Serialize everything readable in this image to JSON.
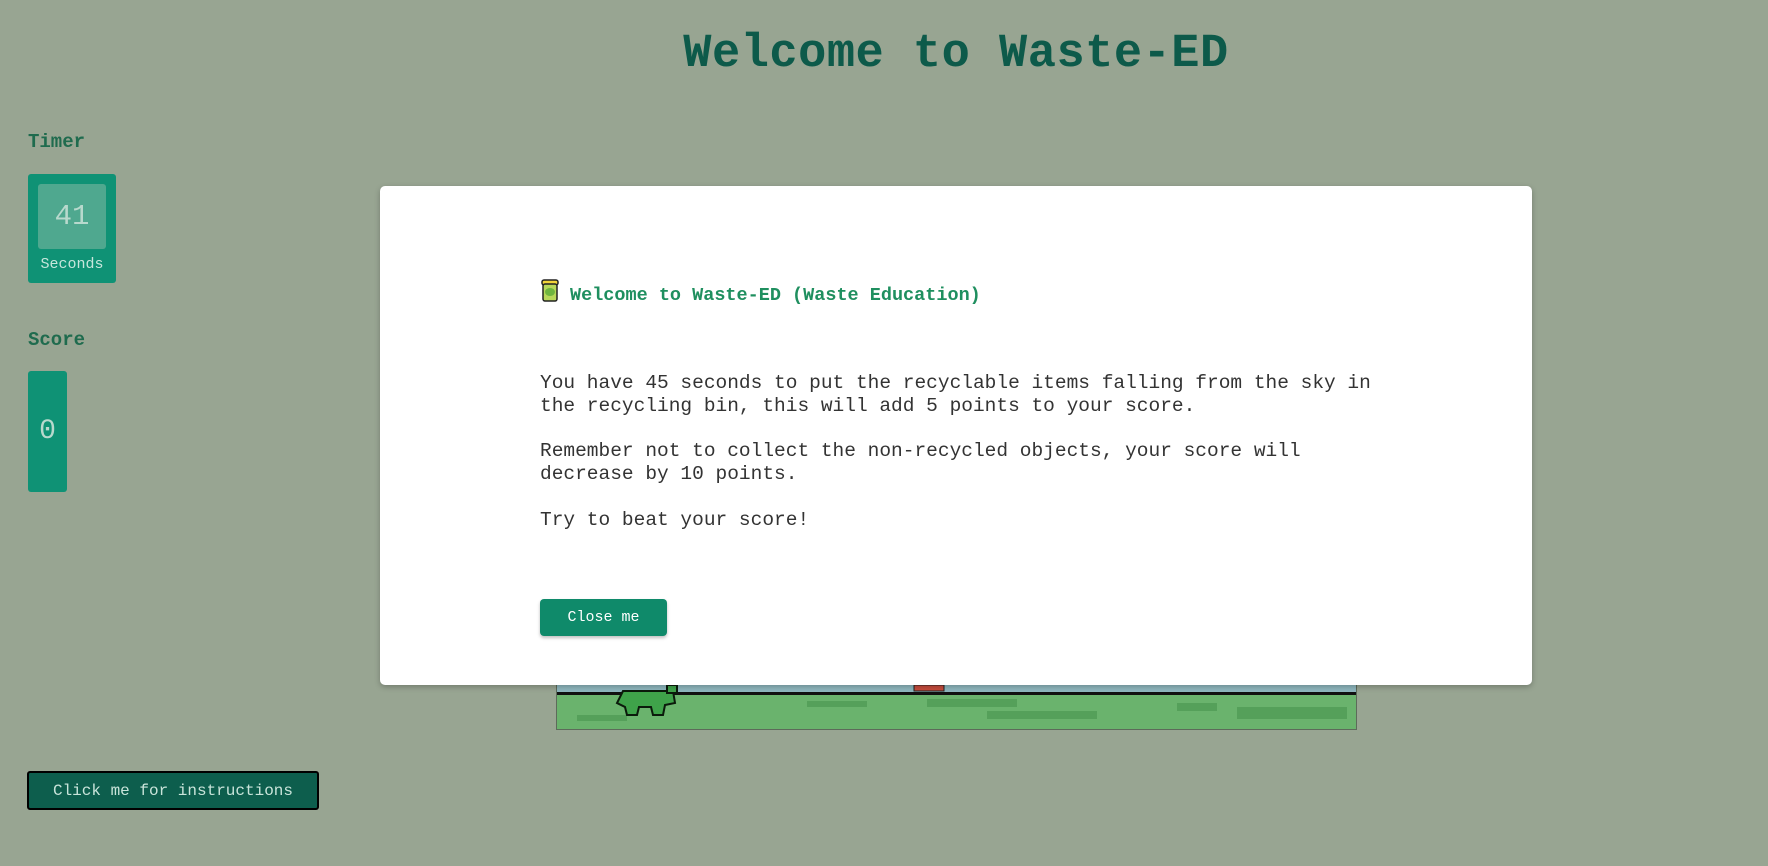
{
  "header": {
    "title": "Welcome to Waste-ED"
  },
  "timer": {
    "label": "Timer",
    "value": "41",
    "unit": "Seconds"
  },
  "score": {
    "label": "Score",
    "value": "0"
  },
  "modal": {
    "heading": "Welcome to Waste-ED (Waste Education)",
    "heading_icon": "recycle-bin-icon",
    "paragraphs": [
      "You have 45 seconds to put the recyclable items falling from the sky in the recycling bin, this will add 5 points to your score.",
      "Remember not to collect the non-recycled objects, your score will decrease by 10 points.",
      "Try to beat your score!"
    ],
    "close_label": "Close me"
  },
  "instructions": {
    "button_label": "Click me for instructions"
  },
  "colors": {
    "page_background": "#98a592",
    "title": "#0d5a4a",
    "panel": "#0f9275",
    "modal_heading": "#1f8f5f",
    "button": "#0f8a6a"
  }
}
